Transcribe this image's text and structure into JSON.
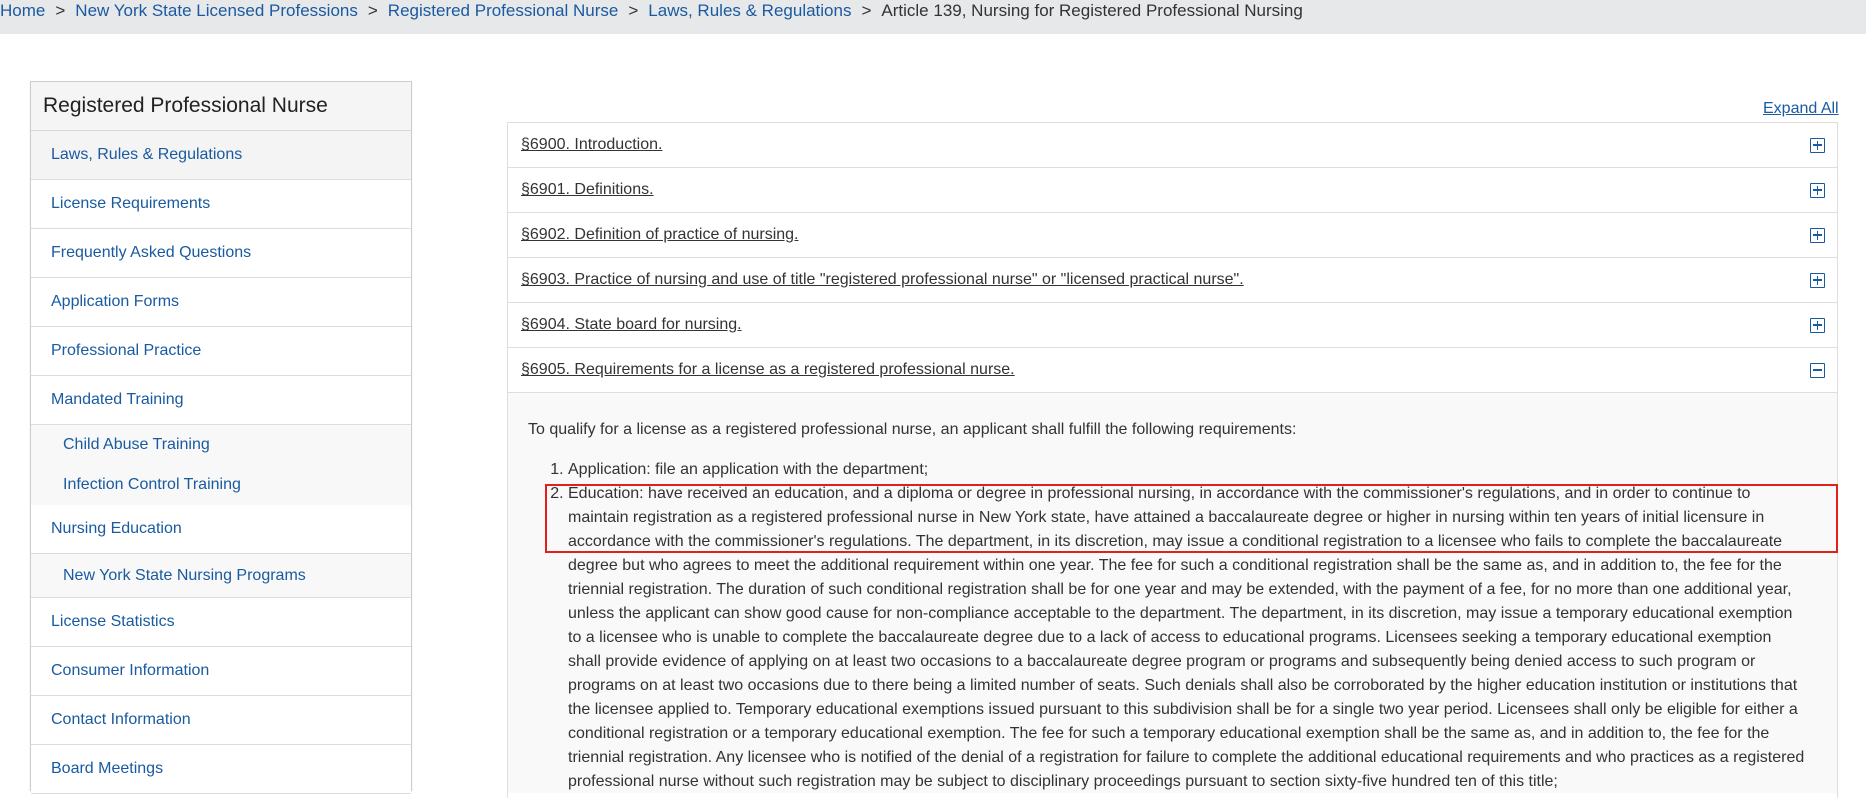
{
  "breadcrumb": {
    "items": [
      "Home",
      "New York State Licensed Professions",
      "Registered Professional Nurse",
      "Laws, Rules & Regulations"
    ],
    "separator": ">",
    "current": "Article 139, Nursing for Registered Professional Nursing"
  },
  "sidebar": {
    "title": "Registered Professional Nurse",
    "items": [
      "Laws, Rules & Regulations",
      "License Requirements",
      "Frequently Asked Questions",
      "Application Forms",
      "Professional Practice",
      "Mandated Training",
      "Nursing Education",
      "License Statistics",
      "Consumer Information",
      "Contact Information",
      "Board Meetings"
    ],
    "mandated_sub": [
      "Child Abuse Training",
      "Infection Control Training"
    ],
    "education_sub": [
      "New York State Nursing Programs"
    ]
  },
  "main": {
    "expand_all": "Expand All",
    "sections": [
      "§6900. Introduction.",
      "§6901. Definitions.",
      "§6902. Definition of practice of nursing.",
      "§6903. Practice of nursing and use of title \"registered professional nurse\" or \"licensed practical nurse\".",
      "§6904. State board for nursing.",
      "§6905. Requirements for a license as a registered professional nurse."
    ],
    "open_section": {
      "intro": "To qualify for a license as a registered professional nurse, an applicant shall fulfill the following requirements:",
      "list": [
        "Application: file an application with the department;",
        "Education: have received an education, and a diploma or degree in professional nursing, in accordance with the commissioner's regulations, and in order to continue to maintain registration as a registered professional nurse in New York state, have attained a baccalaureate degree or higher in nursing within ten years of initial licensure in accordance with the commissioner's regulations. The department, in its discretion, may issue a conditional registration to a licensee who fails to complete the baccalaureate degree but who agrees to meet the additional requirement within one year. The fee for such a conditional registration shall be the same as, and in addition to, the fee for the triennial registration. The duration of such conditional registration shall be for one year and may be extended, with the payment of a fee, for no more than one additional year, unless the applicant can show good cause for non-compliance acceptable to the department. The department, in its discretion, may issue a temporary educational exemption to a licensee who is unable to complete the baccalaureate degree due to a lack of access to educational programs. Licensees seeking a temporary educational exemption shall provide evidence of applying on at least two occasions to a baccalaureate degree program or programs and subsequently being denied access to such program or programs on at least two occasions due to there being a limited number of seats. Such denials shall also be corroborated by the higher education institution or institutions that the licensee applied to. Temporary educational exemptions issued pursuant to this subdivision shall be for a single two year period. Licensees shall only be eligible for either a conditional registration or a temporary educational exemption. The fee for such a temporary educational exemption shall be the same as, and in addition to, the fee for the triennial registration. Any licensee who is notified of the denial of a registration for failure to complete the additional educational requirements and who practices as a registered professional nurse without such registration may be subject to disciplinary proceedings pursuant to section sixty-five hundred ten of this title;"
      ]
    }
  },
  "colors": {
    "link": "#1a5aa0",
    "highlight": "#e0201b",
    "breadcrumb_bg": "#e7e8ea"
  }
}
